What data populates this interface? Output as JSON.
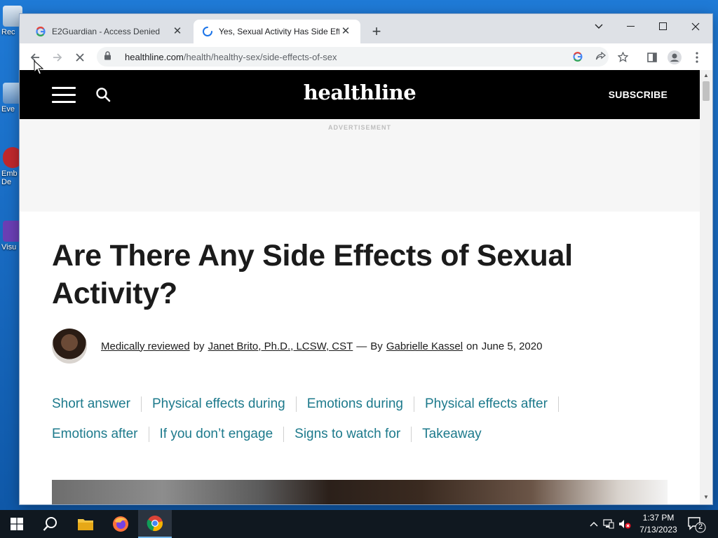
{
  "desktop": {
    "icons": [
      {
        "label": "Rec"
      },
      {
        "label": "Eve"
      },
      {
        "label": "Emb"
      },
      {
        "label": "De"
      },
      {
        "label": "Visu"
      }
    ]
  },
  "browser": {
    "tabs": [
      {
        "title": "E2Guardian - Access Denied",
        "close": "✕"
      },
      {
        "title": "Yes, Sexual Activity Has Side Effects",
        "close": "✕"
      }
    ],
    "new_tab": "+",
    "url_host": "healthline.com",
    "url_path": "/health/healthy-sex/side-effects-of-sex"
  },
  "site": {
    "logo": "healthline",
    "subscribe": "SUBSCRIBE",
    "ad_label": "ADVERTISEMENT"
  },
  "article": {
    "title": "Are There Any Side Effects of Sexual Activity?",
    "byline": {
      "reviewed_label": "Medically reviewed",
      "by1": "by",
      "reviewer": "Janet Brito, Ph.D., LCSW, CST",
      "dash": "—",
      "by2": "By",
      "author": "Gabrielle Kassel",
      "on": "on",
      "date": "June 5, 2020"
    },
    "toc": [
      "Short answer",
      "Physical effects during",
      "Emotions during",
      "Physical effects after",
      "Emotions after",
      "If you don’t engage",
      "Signs to watch for",
      "Takeaway"
    ]
  },
  "taskbar": {
    "time": "1:37 PM",
    "date": "7/13/2023",
    "notifications": "2"
  }
}
